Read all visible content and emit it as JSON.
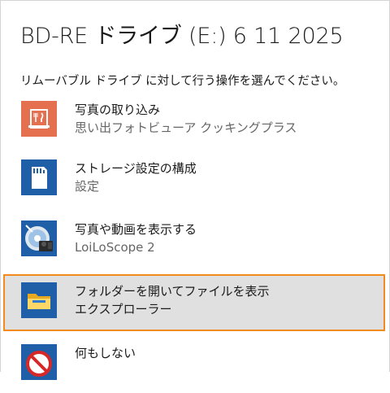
{
  "dialog": {
    "title": "BD-RE ドライブ (E:) 6 11 2025",
    "prompt": "リムーバブル ドライブ に対して行う操作を選んでください。"
  },
  "options": [
    {
      "title": "写真の取り込み",
      "subtitle": "思い出フォトビューア クッキングプラス",
      "icon": "cooking-photo-app-icon"
    },
    {
      "title": "ストレージ設定の構成",
      "subtitle": "設定",
      "icon": "sd-card-icon"
    },
    {
      "title": "写真や動画を表示する",
      "subtitle": "LoiLoScope 2",
      "icon": "loiloscope-icon"
    },
    {
      "title": "フォルダーを開いてファイルを表示",
      "subtitle": "エクスプローラー",
      "icon": "folder-icon",
      "selected": true
    },
    {
      "title": "何もしない",
      "subtitle": "",
      "icon": "no-action-icon"
    }
  ],
  "colors": {
    "selection_border": "#f28a1d",
    "selection_bg": "#e0e0e0",
    "tile_orange": "#e5704f",
    "tile_blue": "#1f5fa8"
  }
}
